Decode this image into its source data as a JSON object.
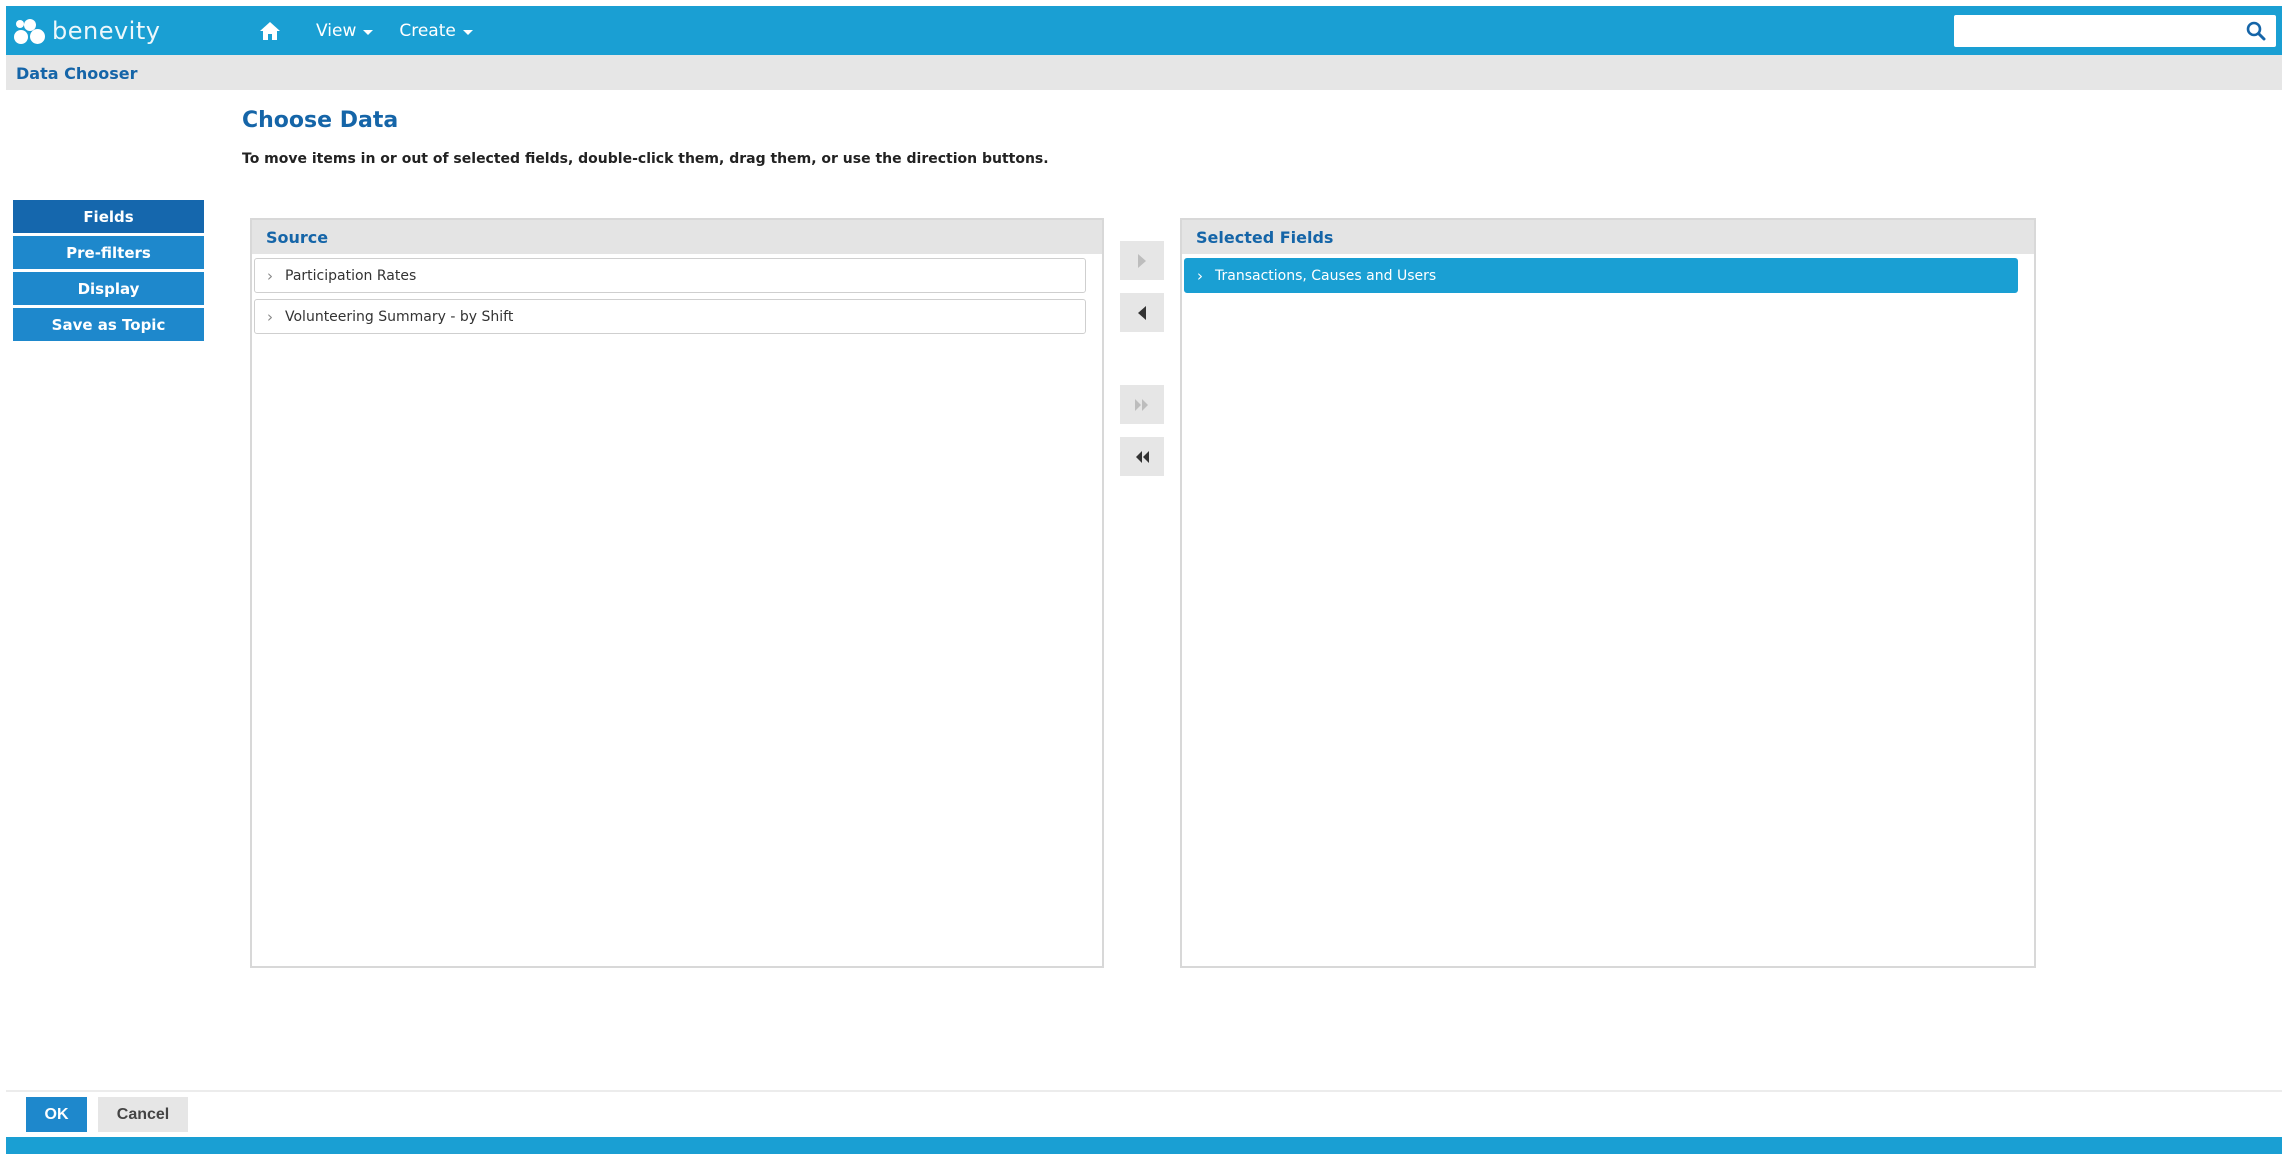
{
  "header": {
    "logo_text": "benevity",
    "nav": [
      {
        "icon": "home-icon"
      },
      {
        "label": "View"
      },
      {
        "label": "Create"
      }
    ],
    "search": {
      "value": "",
      "placeholder": ""
    }
  },
  "breadcrumb": "Data Chooser",
  "page": {
    "title": "Choose Data",
    "instructions": "To move items in or out of selected fields, double-click them, drag them, or use the direction buttons."
  },
  "sidemenu": [
    {
      "label": "Fields",
      "active": true
    },
    {
      "label": "Pre-filters",
      "active": false
    },
    {
      "label": "Display",
      "active": false
    },
    {
      "label": "Save as Topic",
      "active": false
    }
  ],
  "source": {
    "header": "Source",
    "items": [
      "Participation Rates",
      "Volunteering Summary - by Shift"
    ]
  },
  "selected": {
    "header": "Selected Fields",
    "items": [
      "Transactions, Causes and Users"
    ]
  },
  "buttons": {
    "ok": "OK",
    "cancel": "Cancel"
  },
  "colors": {
    "brand": "#1a9fd3",
    "accent": "#1565a8",
    "button": "#1e88cc"
  }
}
